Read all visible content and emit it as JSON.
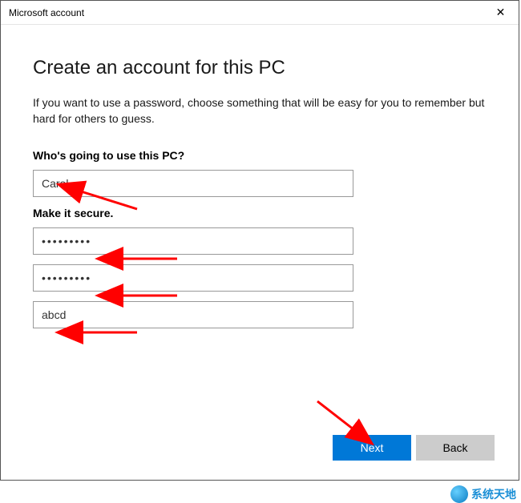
{
  "window": {
    "title": "Microsoft account",
    "close_glyph": "✕"
  },
  "page": {
    "heading": "Create an account for this PC",
    "description": "If you want to use a password, choose something that will be easy for you to remember but hard for others to guess."
  },
  "form": {
    "username_label": "Who's going to use this PC?",
    "username_value": "Carol",
    "secure_label": "Make it secure.",
    "password_value": "•••••••••",
    "confirm_value": "•••••••••",
    "hint_value": "abcd"
  },
  "buttons": {
    "next": "Next",
    "back": "Back"
  },
  "watermark": {
    "text": "系统天地"
  },
  "colors": {
    "primary": "#0078d7",
    "secondary": "#cccccc",
    "arrow": "#ff0000"
  }
}
